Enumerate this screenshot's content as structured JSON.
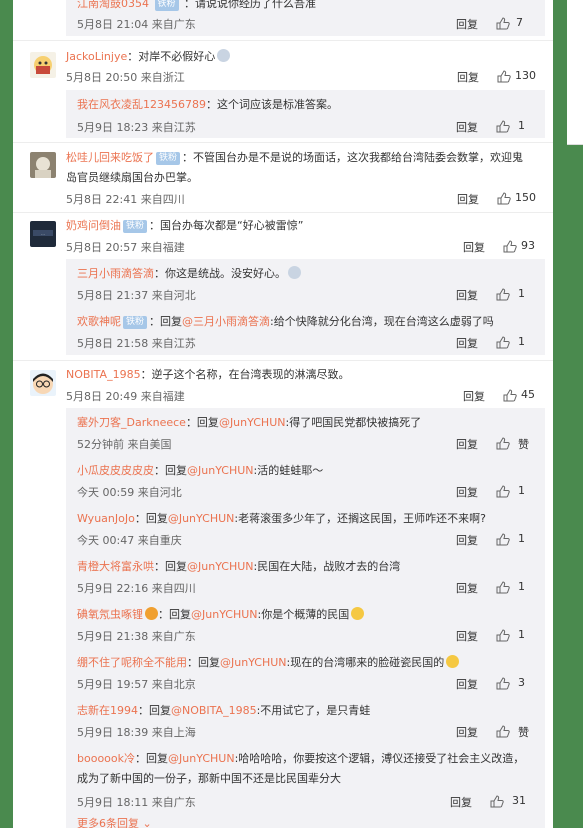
{
  "colors": {
    "background": "#4a8a4e",
    "link": "#eb7350",
    "reply_bg": "#f2f2f5"
  },
  "ui": {
    "reply": "回复",
    "like": "赞",
    "more": "更多6条回复",
    "icon": "like-icon"
  },
  "top_reply": {
    "user": "江南淘鼓0354",
    "badge": "铁粉",
    "text": "：请说说你经历了什么吾准",
    "date": "5月8日 21:04",
    "from": "来自广东",
    "likes": "7"
  },
  "c1": {
    "user": "JackoLinjye",
    "text": "：对岸不必假好心",
    "date": "5月8日 20:50",
    "from": "来自浙江",
    "likes": "130",
    "sub_user": "我在风衣凌乱123456789",
    "sub_text": "：这个词应该是标准答案。",
    "sub_date": "5月9日 18:23",
    "sub_from": "来自江苏",
    "sub_likes": "1"
  },
  "c2": {
    "user": "松哇儿回来吃饭了",
    "badge": "铁粉",
    "text": "：不管国台办是不是说的场面话，这次我都给台湾陆委会数掌，欢迎鬼岛官员继续扇国台办巴掌。",
    "date": "5月8日 22:41",
    "from": "来自四川",
    "likes": "150"
  },
  "c3": {
    "user": "奶鸡问倒油",
    "badge": "铁粉",
    "text": "：国台办每次都是“好心被雷惊”",
    "date": "5月8日 20:57",
    "from": "来自福建",
    "likes": "93",
    "r1_user": "三月小雨滴答滴",
    "r1_text": "：你这是统战。没安好心。",
    "r1_date": "5月8日 21:37",
    "r1_from": "来自河北",
    "r1_likes": "1",
    "r2_user": "欢歌神呢",
    "r2_badge": "铁粉",
    "r2_pre": "：回复",
    "r2_mention": "@三月小雨滴答滴",
    "r2_text": ":给个快降就分化台湾，现在台湾这么虚弱了吗",
    "r2_date": "5月8日 21:58",
    "r2_from": "来自江苏",
    "r2_likes": "1"
  },
  "c4": {
    "user": "NOBITA_1985",
    "text": "：逆子这个名称，在台湾表现的淋漓尽致。",
    "date": "5月8日 20:49",
    "from": "来自福建",
    "likes": "45"
  },
  "c4_replies": [
    {
      "user": "塞外刀客_Darkneece",
      "pre": "：回复",
      "mention": "@JunYCHUN",
      "text": ":得了吧国民党都快被搞死了",
      "date": "52分钟前",
      "from": "来自美国",
      "likes": "赞"
    },
    {
      "user": "小瓜皮皮皮皮皮",
      "pre": "：回复",
      "mention": "@JunYCHUN",
      "text": ":活的蛙蛙耶～",
      "date": "今天 00:59",
      "from": "来自河北",
      "likes": "1"
    },
    {
      "user": "WyuanJoJo",
      "pre": "：回复",
      "mention": "@JunYCHUN",
      "text": ":老蒋滚蛋多少年了，还搁这民国，王师咋还不来啊?",
      "date": "今天 00:47",
      "from": "来自重庆",
      "likes": "1"
    },
    {
      "user": "青橙大将富永哄",
      "pre": "：回复",
      "mention": "@JunYCHUN",
      "text": ":民国在大陆，战败才去的台湾",
      "date": "5月9日 22:16",
      "from": "来自四川",
      "likes": "1"
    },
    {
      "user": "碘氧氖虫啄锂",
      "pre": "：回复",
      "mention": "@JunYCHUN",
      "text": ":你是个概薄的民国",
      "date": "5月9日 21:38",
      "from": "来自广东",
      "likes": "1"
    },
    {
      "user": "绷不住了呢称全不能用",
      "pre": "：回复",
      "mention": "@JunYCHUN",
      "text": ":现在的台湾哪来的脸碰瓷民国的",
      "date": "5月9日 19:57",
      "from": "来自北京",
      "likes": "3"
    },
    {
      "user": "志新在1994",
      "pre": "：回复",
      "mention": "@NOBITA_1985",
      "text": ":不用试它了，是只青蛙",
      "date": "5月9日 18:39",
      "from": "来自上海",
      "likes": "赞"
    },
    {
      "user": "boooook冷",
      "pre": "：回复",
      "mention": "@JunYCHUN",
      "text": ":哈哈哈哈，你要按这个逻辑，溥仪还接受了社会主义改造，成为了新中国的一份子，那新中国不还是比民国辈分大",
      "date": "5月9日 18:11",
      "from": "来自广东",
      "likes": "31"
    }
  ]
}
